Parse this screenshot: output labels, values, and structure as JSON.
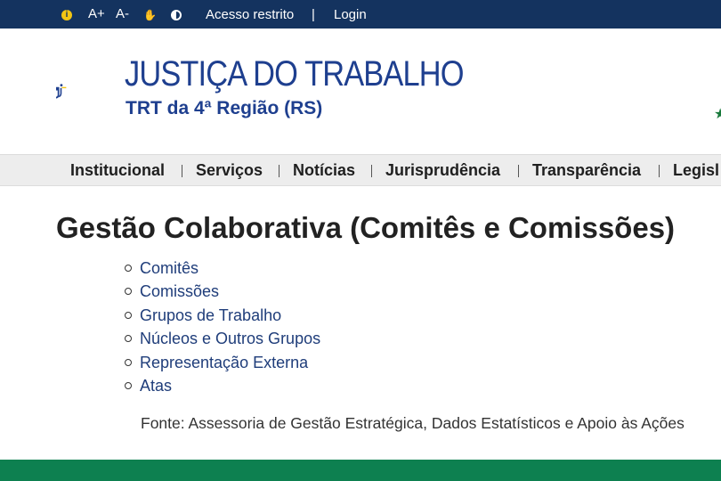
{
  "topbar": {
    "font_increase": "A+",
    "font_decrease": "A-",
    "acesso_restrito": "Acesso restrito",
    "separator": "|",
    "login": "Login",
    "icons": [
      "info-icon",
      "accessibility-icon",
      "contrast-icon"
    ]
  },
  "header": {
    "logo_main": "JUSTIÇA DO TRABALHO",
    "logo_sub": "TRT da 4ª Região (RS)",
    "colors": {
      "brand_blue": "#1e3f8f",
      "brand_yellow": "#f2c514",
      "brand_green": "#1a9a4a"
    }
  },
  "nav": {
    "items": [
      "Institucional",
      "Serviços",
      "Notícias",
      "Jurisprudência",
      "Transparência",
      "Legisl"
    ]
  },
  "main": {
    "title": "Gestão Colaborativa (Comitês e Comissões)",
    "links": [
      "Comitês",
      "Comissões",
      "Grupos de Trabalho",
      "Núcleos e Outros Grupos",
      "Representação Externa",
      "Atas"
    ],
    "fonte": "Fonte: Assessoria de Gestão Estratégica, Dados Estatísticos e Apoio às Ações"
  },
  "colors": {
    "topbar": "#14335f",
    "nav_bg": "#ededed",
    "link": "#1f3d7a",
    "footer": "#0d8050"
  }
}
